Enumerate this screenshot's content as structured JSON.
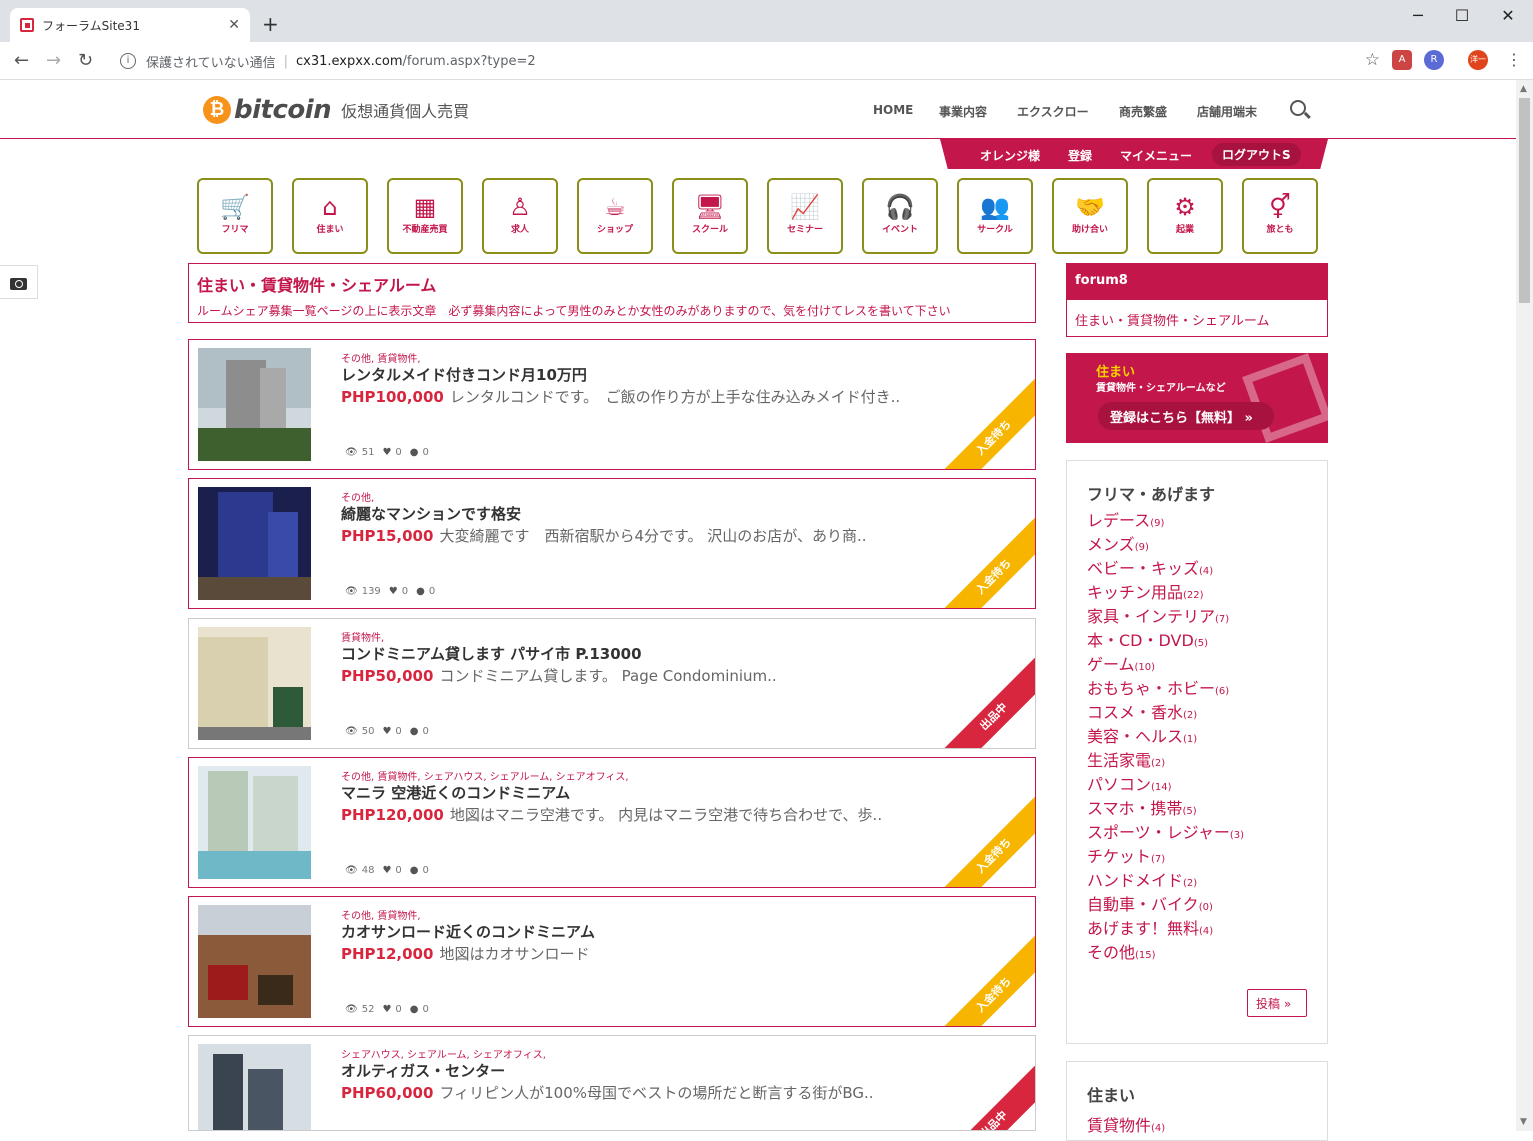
{
  "browser": {
    "tab_title": "フォーラムSite31",
    "security_text": "保護されていない通信",
    "url_host": "cx31.expxx.com",
    "url_path": "/forum.aspx?type=2",
    "profile_initial": "洋一",
    "ext_r": "R"
  },
  "header": {
    "logo_symbol": "₿",
    "logo_word": "bitcoin",
    "logo_sub": "仮想通貨個人売買",
    "nav": [
      "HOME",
      "事業内容",
      "エクスクロー",
      "商売繁盛",
      "店舗用端末"
    ]
  },
  "subnav": {
    "user": "オレンジ様",
    "register": "登録",
    "mymenu": "マイメニュー",
    "logout": "ログアウトS"
  },
  "categories": [
    {
      "label": "フリマ",
      "icon": "cart-icon"
    },
    {
      "label": "住まい",
      "icon": "home-icon"
    },
    {
      "label": "不動産売買",
      "icon": "building-icon"
    },
    {
      "label": "求人",
      "icon": "person-icon"
    },
    {
      "label": "ショップ",
      "icon": "coffee-icon"
    },
    {
      "label": "スクール",
      "icon": "monitor-icon"
    },
    {
      "label": "セミナー",
      "icon": "chart-icon"
    },
    {
      "label": "イベント",
      "icon": "headphones-icon"
    },
    {
      "label": "サークル",
      "icon": "users-icon"
    },
    {
      "label": "助け合い",
      "icon": "handshake-icon"
    },
    {
      "label": "起業",
      "icon": "hubspot-icon"
    },
    {
      "label": "旅とも",
      "icon": "gender-icon"
    }
  ],
  "intro": {
    "title": "住まい・賃貸物件・シェアルーム",
    "text": "ルームシェア募集一覧ページの上に表示文章　必ず募集内容によって男性のみとか女性のみがありますので、気を付けてレスを書いて下さい"
  },
  "listings": [
    {
      "tags": "その他, 賃貸物件,",
      "title": "レンタルメイド付きコンド月10万円",
      "price": "PHP100,000",
      "desc": "レンタルコンドです。　ご飯の作り方が上手な住み込みメイド付き..",
      "views": "51",
      "likes": "0",
      "comments": "0",
      "status": "入金待ち"
    },
    {
      "tags": "その他,",
      "title": "綺麗なマンションです格安",
      "price": "PHP15,000",
      "desc": "大変綺麗です　西新宿駅から4分です。 沢山のお店が、あり商..",
      "views": "139",
      "likes": "0",
      "comments": "0",
      "status": "入金待ち"
    },
    {
      "tags": "賃貸物件,",
      "title": "コンドミニアム貸します パサイ市 P.13000",
      "price": "PHP50,000",
      "desc": "コンドミニアム貸します。 Page Condominium..",
      "views": "50",
      "likes": "0",
      "comments": "0",
      "status": "出品中"
    },
    {
      "tags": "その他, 賃貸物件, シェアハウス, シェアルーム, シェアオフィス,",
      "title": "マニラ 空港近くのコンドミニアム",
      "price": "PHP120,000",
      "desc": "地図はマニラ空港です。 内見はマニラ空港で待ち合わせで、歩..",
      "views": "48",
      "likes": "0",
      "comments": "0",
      "status": "入金待ち"
    },
    {
      "tags": "その他, 賃貸物件,",
      "title": "カオサンロード近くのコンドミニアム",
      "price": "PHP12,000",
      "desc": "地図はカオサンロード",
      "views": "52",
      "likes": "0",
      "comments": "0",
      "status": "入金待ち"
    },
    {
      "tags": "シェアハウス, シェアルーム, シェアオフィス,",
      "title": "オルティガス・センター",
      "price": "PHP60,000",
      "desc": "フィリピン人が100%母国でベストの場所だと断言する街がBG..",
      "views": "",
      "likes": "",
      "comments": "",
      "status": "出品中"
    }
  ],
  "sidebar": {
    "forum_title": "forum8",
    "forum_link": "住まい・賃貸物件・シェアルーム",
    "banner_title": "住まい",
    "banner_sub": "賃貸物件・シェアルームなど",
    "banner_cta": "登録はこちら【無料】 »",
    "flea_title": "フリマ・あげます",
    "flea_items": [
      {
        "name": "レデース",
        "count": "(9)"
      },
      {
        "name": "メンズ",
        "count": "(9)"
      },
      {
        "name": "ベビー・キッズ",
        "count": "(4)"
      },
      {
        "name": "キッチン用品",
        "count": "(22)"
      },
      {
        "name": "家具・インテリア",
        "count": "(7)"
      },
      {
        "name": "本・CD・DVD",
        "count": "(5)"
      },
      {
        "name": "ゲーム",
        "count": "(10)"
      },
      {
        "name": "おもちゃ・ホビー",
        "count": "(6)"
      },
      {
        "name": "コスメ・香水",
        "count": "(2)"
      },
      {
        "name": "美容・ヘルス",
        "count": "(1)"
      },
      {
        "name": "生活家電",
        "count": "(2)"
      },
      {
        "name": "パソコン",
        "count": "(14)"
      },
      {
        "name": "スマホ・携帯",
        "count": "(5)"
      },
      {
        "name": "スポーツ・レジャー",
        "count": "(3)"
      },
      {
        "name": "チケット",
        "count": "(7)"
      },
      {
        "name": "ハンドメイド",
        "count": "(2)"
      },
      {
        "name": "自動車・バイク",
        "count": "(0)"
      },
      {
        "name": "あげます！無料",
        "count": "(4)"
      },
      {
        "name": "その他",
        "count": "(15)"
      }
    ],
    "post_button": "投稿 »",
    "house_title": "住まい",
    "house_link": "賃貸物件",
    "house_count": "(4)"
  },
  "colors": {
    "accent": "#c3174b",
    "price": "#d7263d",
    "ribbon_wait": "#f7b500",
    "ribbon_sale": "#d7263d",
    "border_icon": "#8a8f1a"
  }
}
